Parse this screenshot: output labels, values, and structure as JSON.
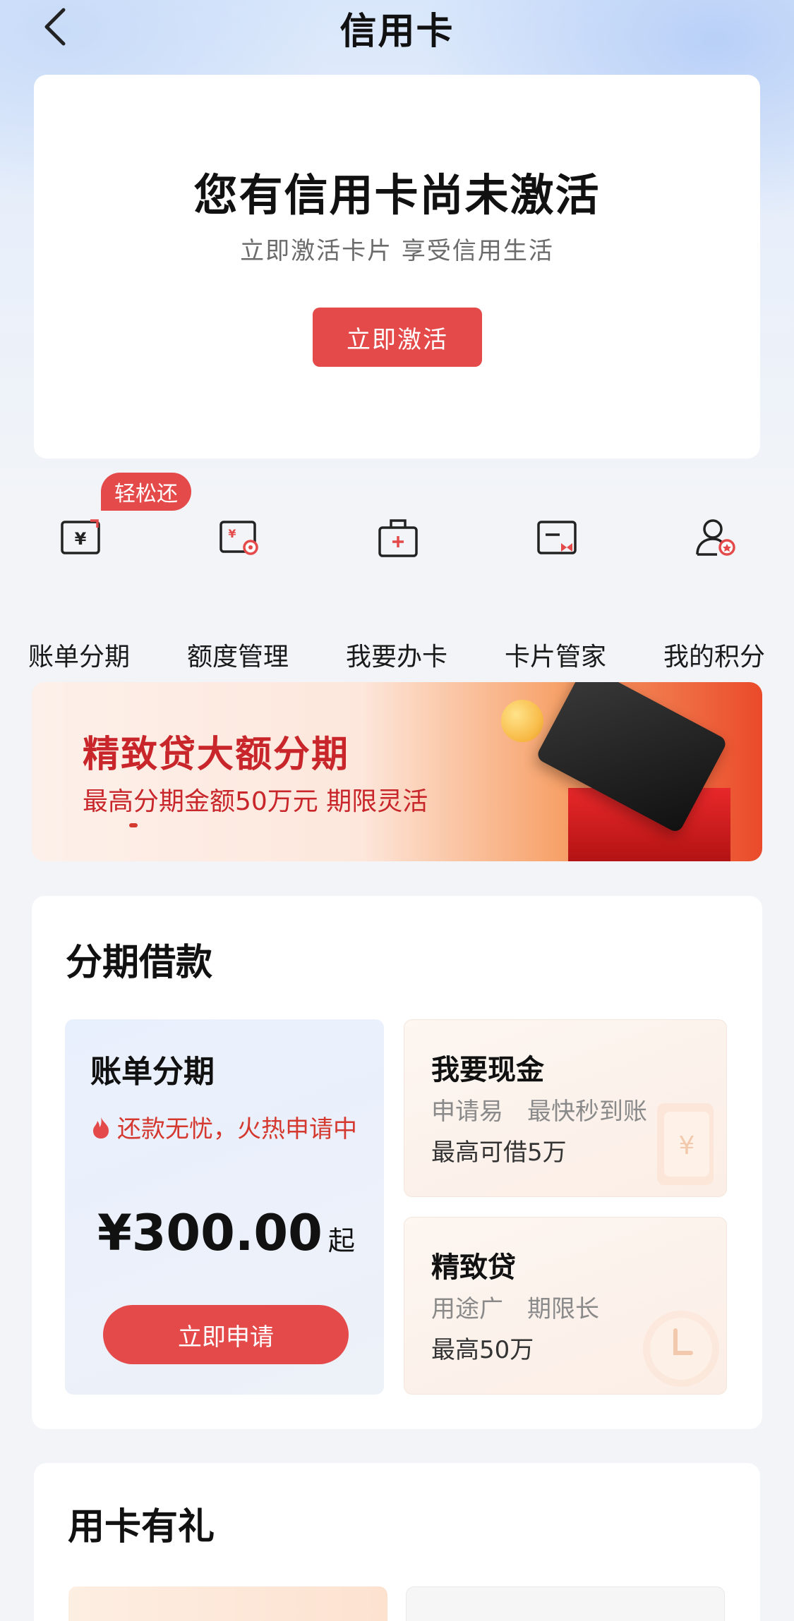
{
  "header": {
    "title": "信用卡"
  },
  "activate": {
    "title": "您有信用卡尚未激活",
    "subtitle": "立即激活卡片 享受信用生活",
    "button": "立即激活"
  },
  "quick_menu": {
    "badge": "轻松还",
    "items": [
      {
        "label": "账单分期",
        "icon": "bill-installment-icon"
      },
      {
        "label": "额度管理",
        "icon": "limit-management-icon"
      },
      {
        "label": "我要办卡",
        "icon": "apply-card-icon"
      },
      {
        "label": "卡片管家",
        "icon": "card-manager-icon"
      },
      {
        "label": "我的积分",
        "icon": "my-points-icon"
      }
    ]
  },
  "banner": {
    "title": "精致贷大额分期",
    "subtitle": "最高分期金额50万元 期限灵活"
  },
  "loans": {
    "title": "分期借款",
    "bill": {
      "title": "账单分期",
      "hot": "还款无忧，火热申请中",
      "amount": "¥300.00",
      "amount_suffix": "起",
      "button": "立即申请"
    },
    "cash": {
      "title": "我要现金",
      "desc": "申请易　最快秒到账",
      "max": "最高可借5万"
    },
    "jingzhi": {
      "title": "精致贷",
      "desc": "用途广　期限长",
      "max": "最高50万"
    }
  },
  "gift": {
    "title": "用卡有礼"
  },
  "colors": {
    "accent": "#e44a4a",
    "hot_text": "#d4382e",
    "banner_text": "#c8262a"
  }
}
